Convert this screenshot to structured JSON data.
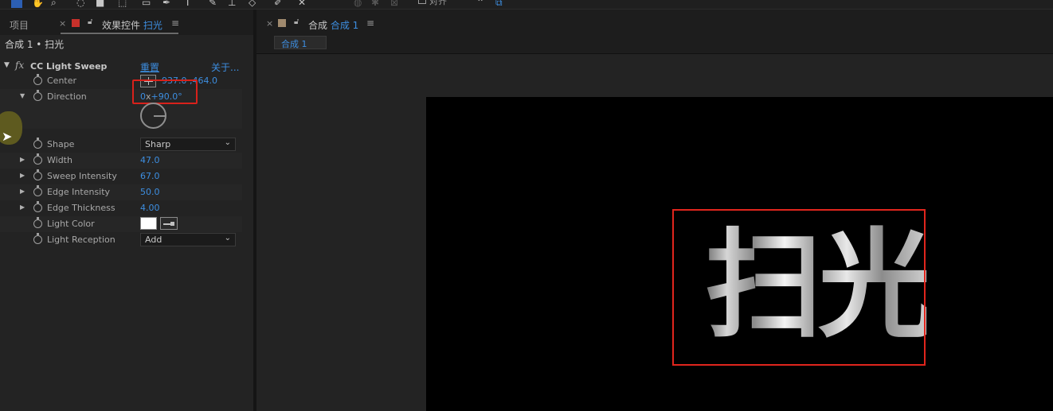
{
  "toolbar": {
    "snap_label": "对齐"
  },
  "left_panel": {
    "tabs": {
      "project_label": "项目",
      "close_glyph": "×",
      "effect_controls_label": "效果控件",
      "effect_controls_layer": "扫光",
      "menu_glyph": "≡"
    },
    "breadcrumb": "合成 1 • 扫光",
    "effect": {
      "name": "CC Light Sweep",
      "reset_label": "重置",
      "about_label": "关于...",
      "properties": [
        {
          "name": "Center",
          "value": "937.0 ,464.0"
        },
        {
          "name": "Direction",
          "value_prefix": "0",
          "value_x": "x",
          "value": "+90.0°"
        },
        {
          "name": "Shape",
          "value": "Sharp"
        },
        {
          "name": "Width",
          "value": "47.0"
        },
        {
          "name": "Sweep Intensity",
          "value": "67.0"
        },
        {
          "name": "Edge Intensity",
          "value": "50.0"
        },
        {
          "name": "Edge Thickness",
          "value": "4.00"
        },
        {
          "name": "Light Color",
          "value": "#ffffff"
        },
        {
          "name": "Light Reception",
          "value": "Add"
        }
      ]
    }
  },
  "right_panel": {
    "tab": {
      "close_glyph": "×",
      "label": "合成",
      "comp_name": "合成 1",
      "menu_glyph": "≡"
    },
    "subtab_label": "合成 1",
    "canvas_text": "扫光"
  },
  "colors": {
    "accent_blue": "#3d8ee0",
    "highlight_red": "#d8211b",
    "panel_bg": "#232323"
  }
}
